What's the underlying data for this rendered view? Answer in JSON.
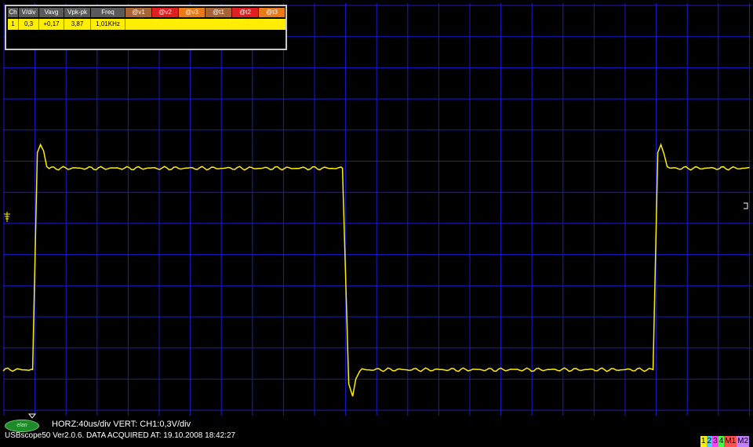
{
  "measurement_table": {
    "headers": [
      "Ch",
      "V/div",
      "Vavg",
      "Vpk-pk",
      "Freq",
      "@v1",
      "@v2",
      "@v3",
      "@t1",
      "@t2",
      "@t3"
    ],
    "row": [
      "1",
      "0,3",
      "+0,17",
      "3,87",
      "1,01KHz"
    ]
  },
  "status": {
    "scale_line": "HORZ:40us/div VERT: CH1:0,3V/div",
    "info_line": "USBscope50 Ver2.0.6.  DATA ACQUIRED AT: 19.10.2008 18:42:27",
    "logo_text": "elan"
  },
  "channel_legend": [
    {
      "label": "1",
      "color": "#ffee00"
    },
    {
      "label": "2",
      "color": "#40d0ff"
    },
    {
      "label": "3",
      "color": "#ff40ff"
    },
    {
      "label": "4",
      "color": "#40ff40"
    },
    {
      "label": "M1",
      "color": "#ff5050"
    },
    {
      "label": "M2",
      "color": "#c080ff"
    }
  ],
  "colors": {
    "background": "#000000",
    "grid": "#1a1ad0",
    "trace_ch1": "#ffee00",
    "panel_border": "#c8c8c8"
  },
  "trace": {
    "channel": "1",
    "waveform": "square",
    "high_level_div": 8.0,
    "low_level_div": 1.0,
    "rise_1_div": 1.0,
    "fall_div": 11.0,
    "rise_2_div": 21.0
  }
}
